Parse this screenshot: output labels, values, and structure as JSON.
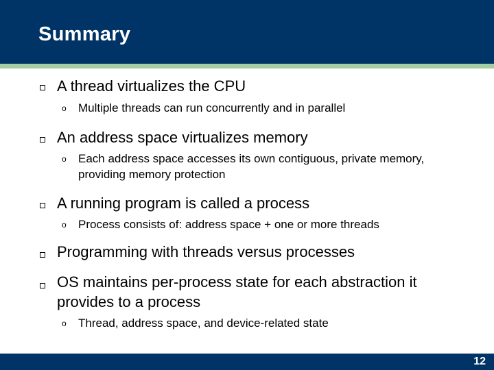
{
  "slide": {
    "title": "Summary",
    "page_number": "12",
    "colors": {
      "header": "#003366",
      "accent": "#a3cda2",
      "footer": "#003366"
    },
    "bullet_icon": "hollow-square",
    "sub_bullet_icon": "hollow-circle",
    "sub_bullet_glyph": "o",
    "items": [
      {
        "text": "A thread virtualizes the CPU",
        "subitems": [
          "Multiple threads can run concurrently and in parallel"
        ]
      },
      {
        "text": "An address space virtualizes memory",
        "subitems": [
          "Each address space accesses its own contiguous, private memory, providing memory protection"
        ]
      },
      {
        "text": "A running program is called a process",
        "subitems": [
          "Process consists of: address space + one or more threads"
        ]
      },
      {
        "text": "Programming with threads versus processes",
        "subitems": []
      },
      {
        "text": "OS maintains per-process state for each abstraction it provides to a process",
        "subitems": [
          "Thread, address space, and device-related state"
        ]
      }
    ]
  }
}
